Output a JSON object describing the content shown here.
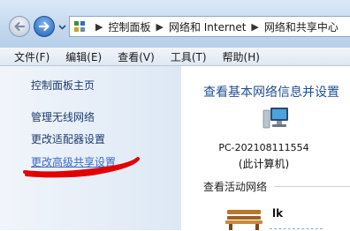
{
  "address": {
    "crumbs": [
      "控制面板",
      "网络和 Internet",
      "网络和共享中心"
    ]
  },
  "menu": [
    "文件(F)",
    "编辑(E)",
    "查看(V)",
    "工具(T)",
    "帮助(H)"
  ],
  "sidebar": {
    "links": [
      "控制面板主页",
      "管理无线网络",
      "更改适配器设置",
      "更改高级共享设置"
    ]
  },
  "main": {
    "title": "查看基本网络信息并设置",
    "computer_name": "PC-202108111554",
    "computer_sub": "(此计算机)",
    "active_networks_label": "查看活动网络",
    "network_name": "lk"
  },
  "colors": {
    "link": "#1e3c6e",
    "highlighted_link": "#3a68c8",
    "title": "#1f4f95",
    "annotation": "#e30000"
  },
  "icons": [
    "back-arrow-icon",
    "forward-arrow-icon",
    "control-panel-icon",
    "computer-icon",
    "bench-network-icon"
  ]
}
